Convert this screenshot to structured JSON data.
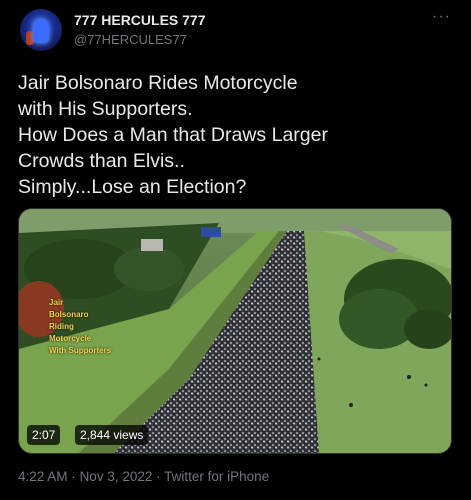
{
  "author": {
    "display_name": "777 HERCULES 777",
    "handle": "@77HERCULES77"
  },
  "more_icon": "more-horizontal-icon",
  "tweet": {
    "lines": [
      "Jair Bolsonaro Rides Motorcycle",
      "with His Supporters.",
      "How Does a Man that Draws Larger",
      "Crowds than Elvis..",
      "Simply...Lose an Election?"
    ]
  },
  "media": {
    "overlay_caption": [
      "Jair",
      "Bolsonaro",
      "Riding",
      "Motorcycle",
      "With Supporters"
    ],
    "duration": "2:07",
    "views": "2,844 views"
  },
  "meta": {
    "time": "4:22 AM",
    "separator": "·",
    "date": "Nov 3, 2022",
    "source": "Twitter for iPhone"
  },
  "colors": {
    "background": "#000000",
    "primary_text": "#e7e9ea",
    "secondary_text": "#71767b",
    "overlay_caption": "#f2d64b"
  }
}
